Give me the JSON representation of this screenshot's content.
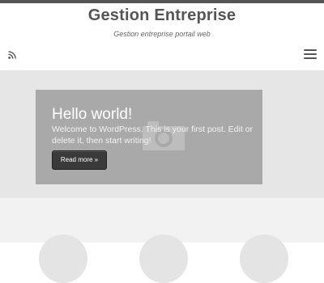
{
  "header": {
    "site_title": "Gestion Entreprise",
    "tagline": "Gestion entreprise portail web",
    "rss_icon": "rss-icon",
    "menu_icon": "hamburger-menu-icon"
  },
  "slider": {
    "title": "Hello world!",
    "excerpt": "Welcome to WordPress. This is your first post. Edit or delete it, then start writing!",
    "button_label": "Read more »",
    "image_icon": "camera-placeholder-icon"
  },
  "colors": {
    "topline": "#555555",
    "hero_background": "#e6e6e6",
    "slide_background": "#a9a9a9",
    "button_background": "#3a3a3a"
  }
}
